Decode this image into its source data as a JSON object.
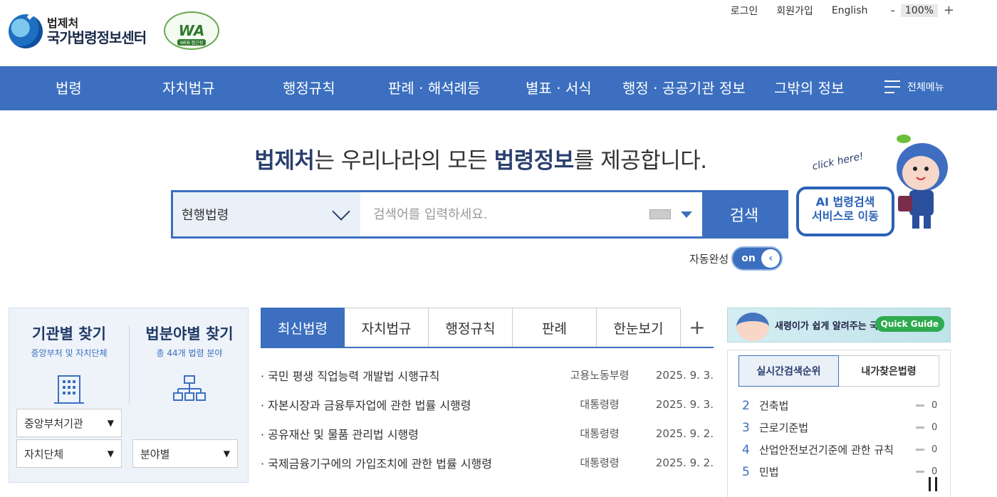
{
  "header": {
    "logo_small": "법제처",
    "logo_big": "국가법령정보센터",
    "wa_badge": "WA",
    "wa_caption": "WEB 접근성",
    "util": {
      "login": "로그인",
      "join": "회원가입",
      "english": "English"
    },
    "zoom": {
      "minus": "-",
      "value": "100%",
      "plus": "+"
    }
  },
  "nav": {
    "items": [
      "법령",
      "자치법규",
      "행정규칙",
      "판례 · 해석례등",
      "별표 · 서식",
      "행정 · 공공기관 정보",
      "그밖의 정보"
    ],
    "all_menu": "전체메뉴"
  },
  "hero": {
    "title_bold1": "법제처",
    "title_mid": "는 우리나라의 모든 ",
    "title_bold2": "법령정보",
    "title_end": "를 제공합니다."
  },
  "search": {
    "select_value": "현행법령",
    "placeholder": "검색어를 입력하세요.",
    "button": "검색",
    "autocomplete_label": "자동완성",
    "toggle_on": "on"
  },
  "ai": {
    "click": "click here!",
    "line1": "AI 법령검색",
    "line2": "서비스로 이동"
  },
  "finder": {
    "agency_title": "기관별 찾기",
    "agency_sub": "중앙부처 및 자치단체",
    "field_title": "법분야별 찾기",
    "field_sub": "총 44개 법령 분야",
    "dd_central": "중앙부처기관",
    "dd_local": "자치단체",
    "dd_field": "분야별"
  },
  "tabs": [
    "최신법령",
    "자치법규",
    "행정규칙",
    "판례",
    "한눈보기"
  ],
  "news": [
    {
      "title": "· 국민 평생 직업능력 개발법 시행규칙",
      "org": "고용노동부령",
      "date": "2025. 9. 3."
    },
    {
      "title": "· 자본시장과 금융투자업에 관한 법률 시행령",
      "org": "대통령령",
      "date": "2025. 9. 3."
    },
    {
      "title": "· 공유재산 및 물품 관리법 시행령",
      "org": "대통령령",
      "date": "2025. 9. 2."
    },
    {
      "title": "· 국제금융기구에의 가입조치에 관한 법률 시행령",
      "org": "대통령령",
      "date": "2025. 9. 2."
    }
  ],
  "quick_guide": {
    "text": "새령이가 쉽게 알려주는 국법",
    "pill": "Quick Guide"
  },
  "ranking": {
    "tab_active": "실시간검색순위",
    "tab_other": "내가찾은법령",
    "items": [
      {
        "rank": "2",
        "name": "건축법",
        "change": "0"
      },
      {
        "rank": "3",
        "name": "근로기준법",
        "change": "0"
      },
      {
        "rank": "4",
        "name": "산업안전보건기준에 관한 규칙",
        "change": "0"
      },
      {
        "rank": "5",
        "name": "민법",
        "change": "0"
      }
    ]
  },
  "colors": {
    "primary": "#3c6fbf",
    "navy": "#2a3f6e",
    "panel": "#eef3fa"
  }
}
